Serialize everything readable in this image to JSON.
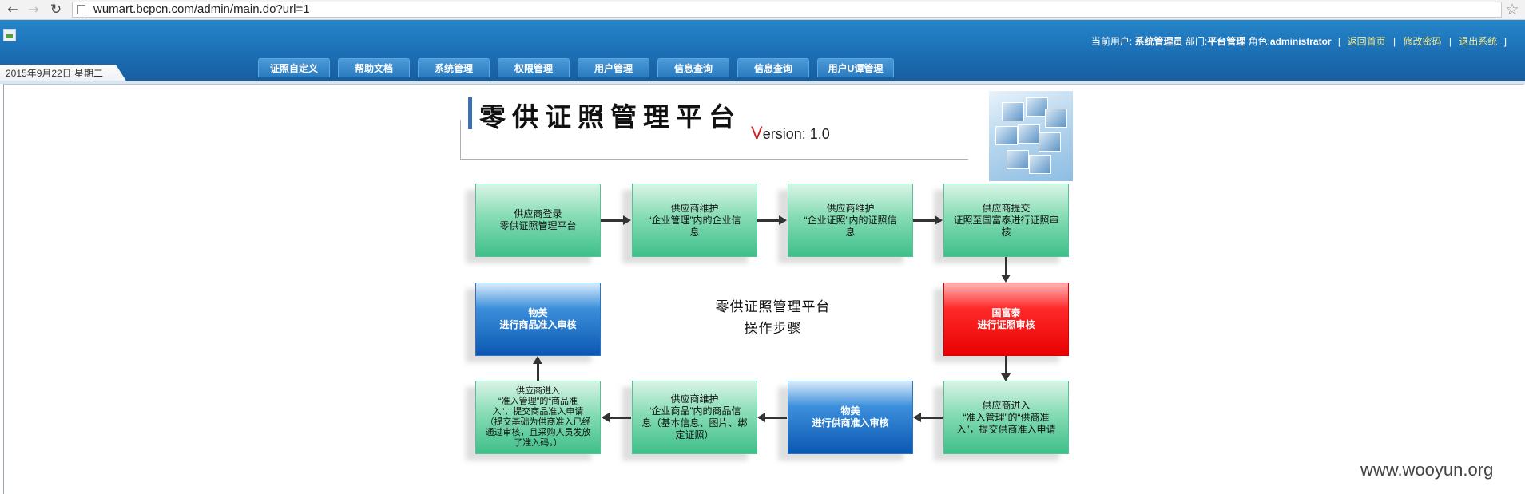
{
  "browser": {
    "url": "wumart.bcpcn.com/admin/main.do?url=1"
  },
  "header": {
    "user_label": "当前用户:",
    "user_name": "系统管理员",
    "dept_label": "部门:",
    "dept_name": "平台管理",
    "role_label": "角色:",
    "role_name": "administrator",
    "bracket_open": "[",
    "link_home": "返回首页",
    "sep1": "|",
    "link_password": "修改密码",
    "sep2": "|",
    "link_logout": "退出系统",
    "bracket_close": "]",
    "date": "2015年9月22日 星期二"
  },
  "menu": {
    "items": [
      {
        "label": "证照自定义"
      },
      {
        "label": "帮助文档"
      },
      {
        "label": "系统管理"
      },
      {
        "label": "权限管理"
      },
      {
        "label": "用户管理"
      },
      {
        "label": "信息查询"
      },
      {
        "label": "信息查询"
      },
      {
        "label": "用户U谭管理"
      }
    ]
  },
  "main": {
    "title": "零供证照管理平台",
    "version_v": "V",
    "version_rest": "ersion: 1.0",
    "center_caption_line1": "零供证照管理平台",
    "center_caption_line2": "操作步骤",
    "steps": [
      {
        "text": "供应商登录\n零供证照管理平台",
        "color": "green"
      },
      {
        "text": "供应商维护\n“企业管理”内的企业信\n息",
        "color": "green"
      },
      {
        "text": "供应商维护\n“企业证照”内的证照信\n息",
        "color": "green"
      },
      {
        "text": "供应商提交\n证照至国富泰进行证照审\n核",
        "color": "green"
      },
      {
        "text": "国富泰\n进行证照审核",
        "color": "red"
      },
      {
        "text": "供应商进入\n“准入管理”的“供商准\n入”，提交供商准入申请",
        "color": "green"
      },
      {
        "text": "物美\n进行供商准入审核",
        "color": "blue"
      },
      {
        "text": "供应商维护\n“企业商品”内的商品信\n息（基本信息、图片、绑\n定证照）",
        "color": "green"
      },
      {
        "text": "供应商进入\n“准入管理”的“商品准\n入”，提交商品准入申请\n（提交基础为供商准入已经\n通过审核，且采购人员发放\n了准入码。）",
        "color": "green"
      },
      {
        "text": "物美\n进行商品准入审核",
        "color": "blue"
      }
    ]
  },
  "watermark": "www.wooyun.org",
  "colors": {
    "header_blue": "#1c6fb5",
    "green_box": "#3fbf8a",
    "blue_box": "#0b58b3",
    "red_box": "#e80000",
    "link_yellow": "#f4e98a"
  }
}
